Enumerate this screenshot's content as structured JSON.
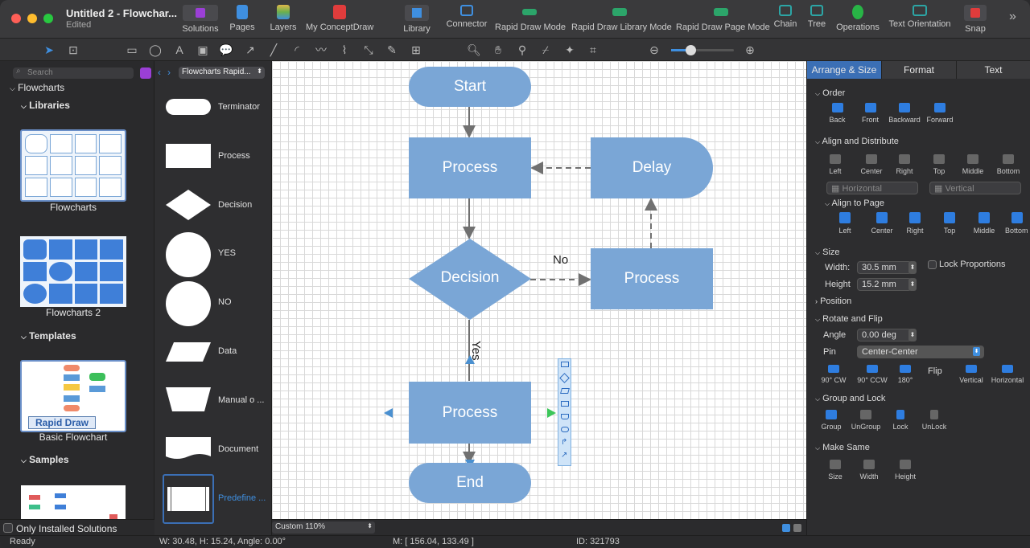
{
  "window": {
    "title": "Untitled 2 - Flowchar...",
    "subtitle": "Edited"
  },
  "toolbar": {
    "solutions": "Solutions",
    "pages": "Pages",
    "layers": "Layers",
    "myconceptdraw": "My ConceptDraw",
    "library": "Library",
    "connector": "Connector",
    "rapid_draw_mode": "Rapid Draw Mode",
    "rapid_draw_library_mode": "Rapid Draw Library Mode",
    "rapid_draw_page_mode": "Rapid Draw Page Mode",
    "chain": "Chain",
    "tree": "Tree",
    "operations": "Operations",
    "text_orientation": "Text Orientation",
    "snap": "Snap"
  },
  "left": {
    "search_placeholder": "Search",
    "root": "Flowcharts",
    "libraries": "Libraries",
    "lib1": "Flowcharts",
    "lib2": "Flowcharts 2",
    "templates": "Templates",
    "template_badge": "Rapid Draw",
    "template1": "Basic Flowchart",
    "samples": "Samples",
    "only_installed": "Only Installed Solutions"
  },
  "shapes": {
    "library_select": "Flowcharts Rapid...",
    "items": [
      "Terminator",
      "Process",
      "Decision",
      "YES",
      "NO",
      "Data",
      "Manual o ...",
      "Document",
      "Predefine ..."
    ]
  },
  "diagram": {
    "start": "Start",
    "process1": "Process",
    "delay": "Delay",
    "decision": "Decision",
    "no_label": "No",
    "process2": "Process",
    "yes_label": "Yes",
    "process3": "Process",
    "end": "End"
  },
  "zoom": {
    "value": "Custom 110%"
  },
  "right": {
    "tabs": [
      "Arrange & Size",
      "Format",
      "Text"
    ],
    "order": "Order",
    "order_items": [
      "Back",
      "Front",
      "Backward",
      "Forward"
    ],
    "align_distribute": "Align and Distribute",
    "align_items": [
      "Left",
      "Center",
      "Right",
      "Top",
      "Middle",
      "Bottom"
    ],
    "horizontal": "Horizontal",
    "vertical": "Vertical",
    "align_page": "Align to Page",
    "align_page_items": [
      "Left",
      "Center",
      "Right",
      "Top",
      "Middle",
      "Bottom"
    ],
    "size": "Size",
    "width_label": "Width:",
    "width_value": "30.5 mm",
    "height_label": "Height",
    "height_value": "15.2 mm",
    "lock_proportions": "Lock Proportions",
    "position": "Position",
    "rotate_flip": "Rotate and Flip",
    "angle_label": "Angle",
    "angle_value": "0.00 deg",
    "pin_label": "Pin",
    "pin_value": "Center-Center",
    "rotate_items": [
      "90° CW",
      "90° CCW",
      "180°"
    ],
    "flip": "Flip",
    "flip_items": [
      "Vertical",
      "Horizontal"
    ],
    "group_lock": "Group and Lock",
    "group_items": [
      "Group",
      "UnGroup",
      "Lock",
      "UnLock"
    ],
    "make_same": "Make Same",
    "same_items": [
      "Size",
      "Width",
      "Height"
    ]
  },
  "status": {
    "ready": "Ready",
    "dims": "W: 30.48,  H: 15.24,  Angle: 0.00°",
    "mouse": "M: [ 156.04, 133.49 ]",
    "id": "ID: 321793"
  },
  "colors": {
    "node": "#7aa6d6",
    "accent_tab": "#3b6fb5",
    "close": "#fe5f57",
    "min": "#febc2e",
    "max": "#28c840"
  }
}
